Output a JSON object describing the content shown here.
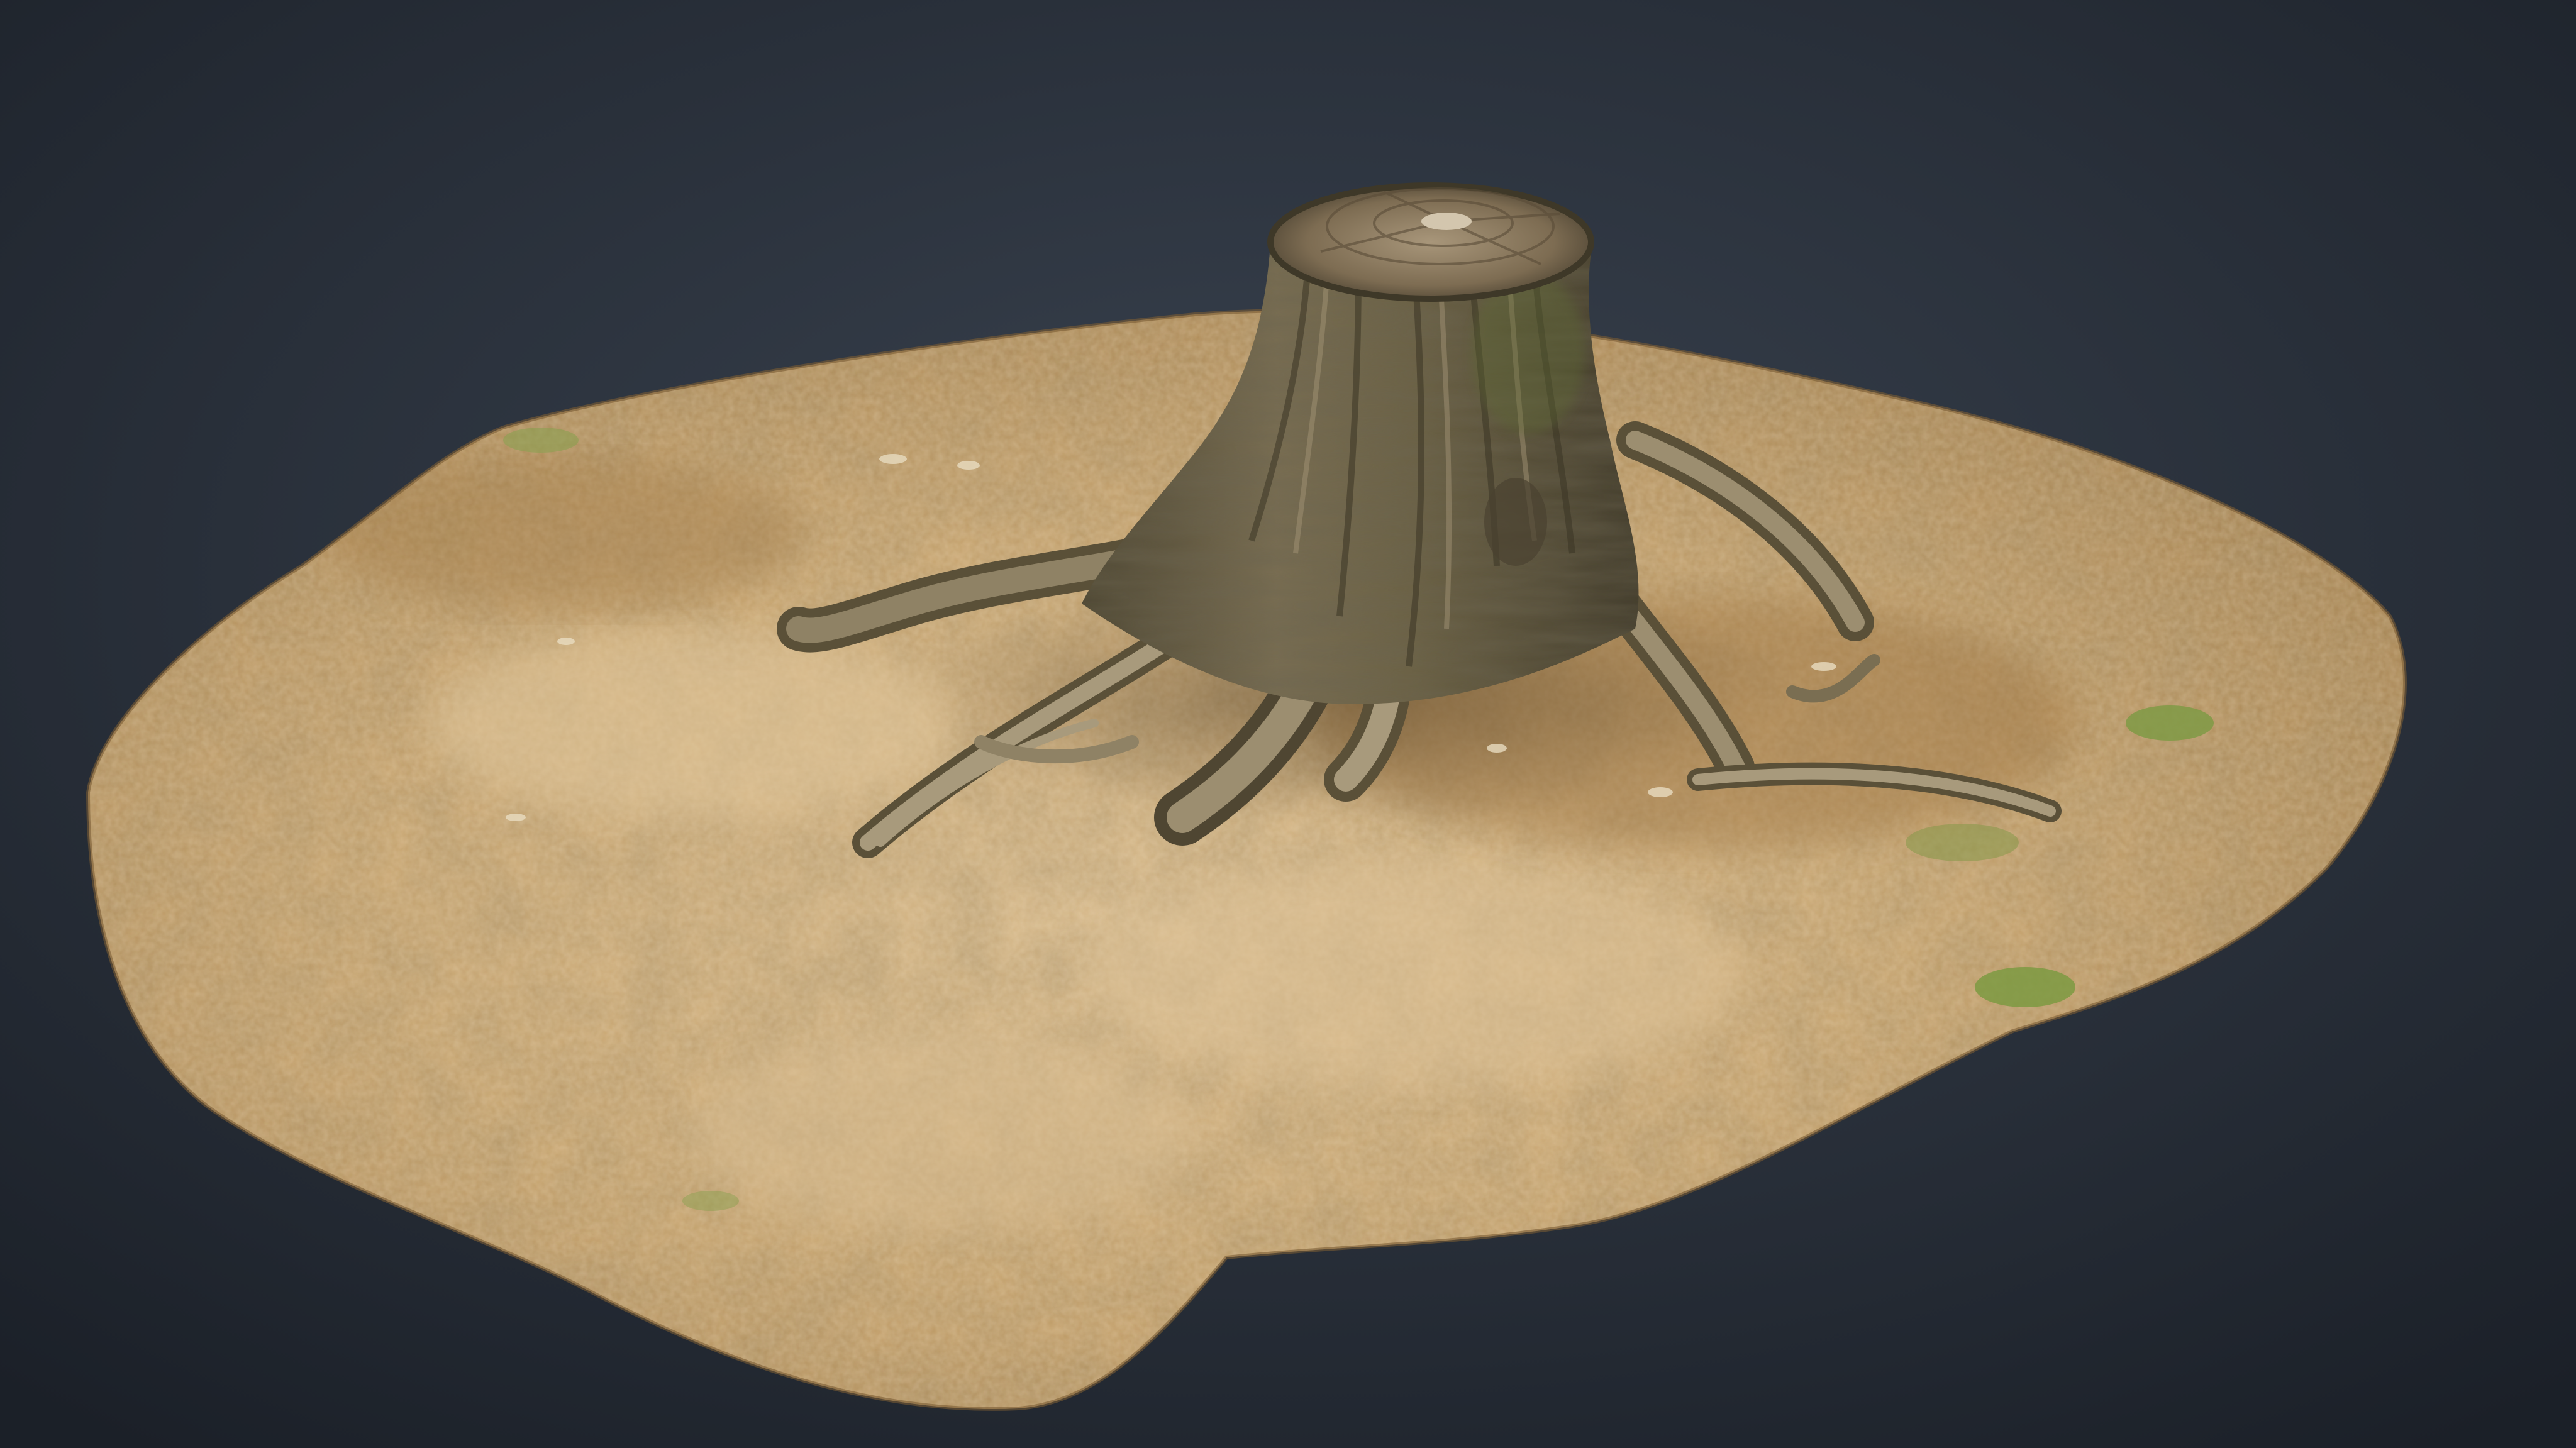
{
  "scene": {
    "subject": "tree-stump-on-forest-ground-3d-scan",
    "colors": {
      "background_center": "#3a4350",
      "background_edge": "#1b2028",
      "ground_light": "#d8b888",
      "ground_mid": "#b8935f",
      "ground_dark": "#8a6a40",
      "moss": "#7f9a45",
      "stump_top": "#8d7b62",
      "stump_bark": "#6e6448",
      "stump_dark": "#3e3828",
      "root_light": "#a89a7c",
      "root_dark": "#5a5038"
    }
  }
}
